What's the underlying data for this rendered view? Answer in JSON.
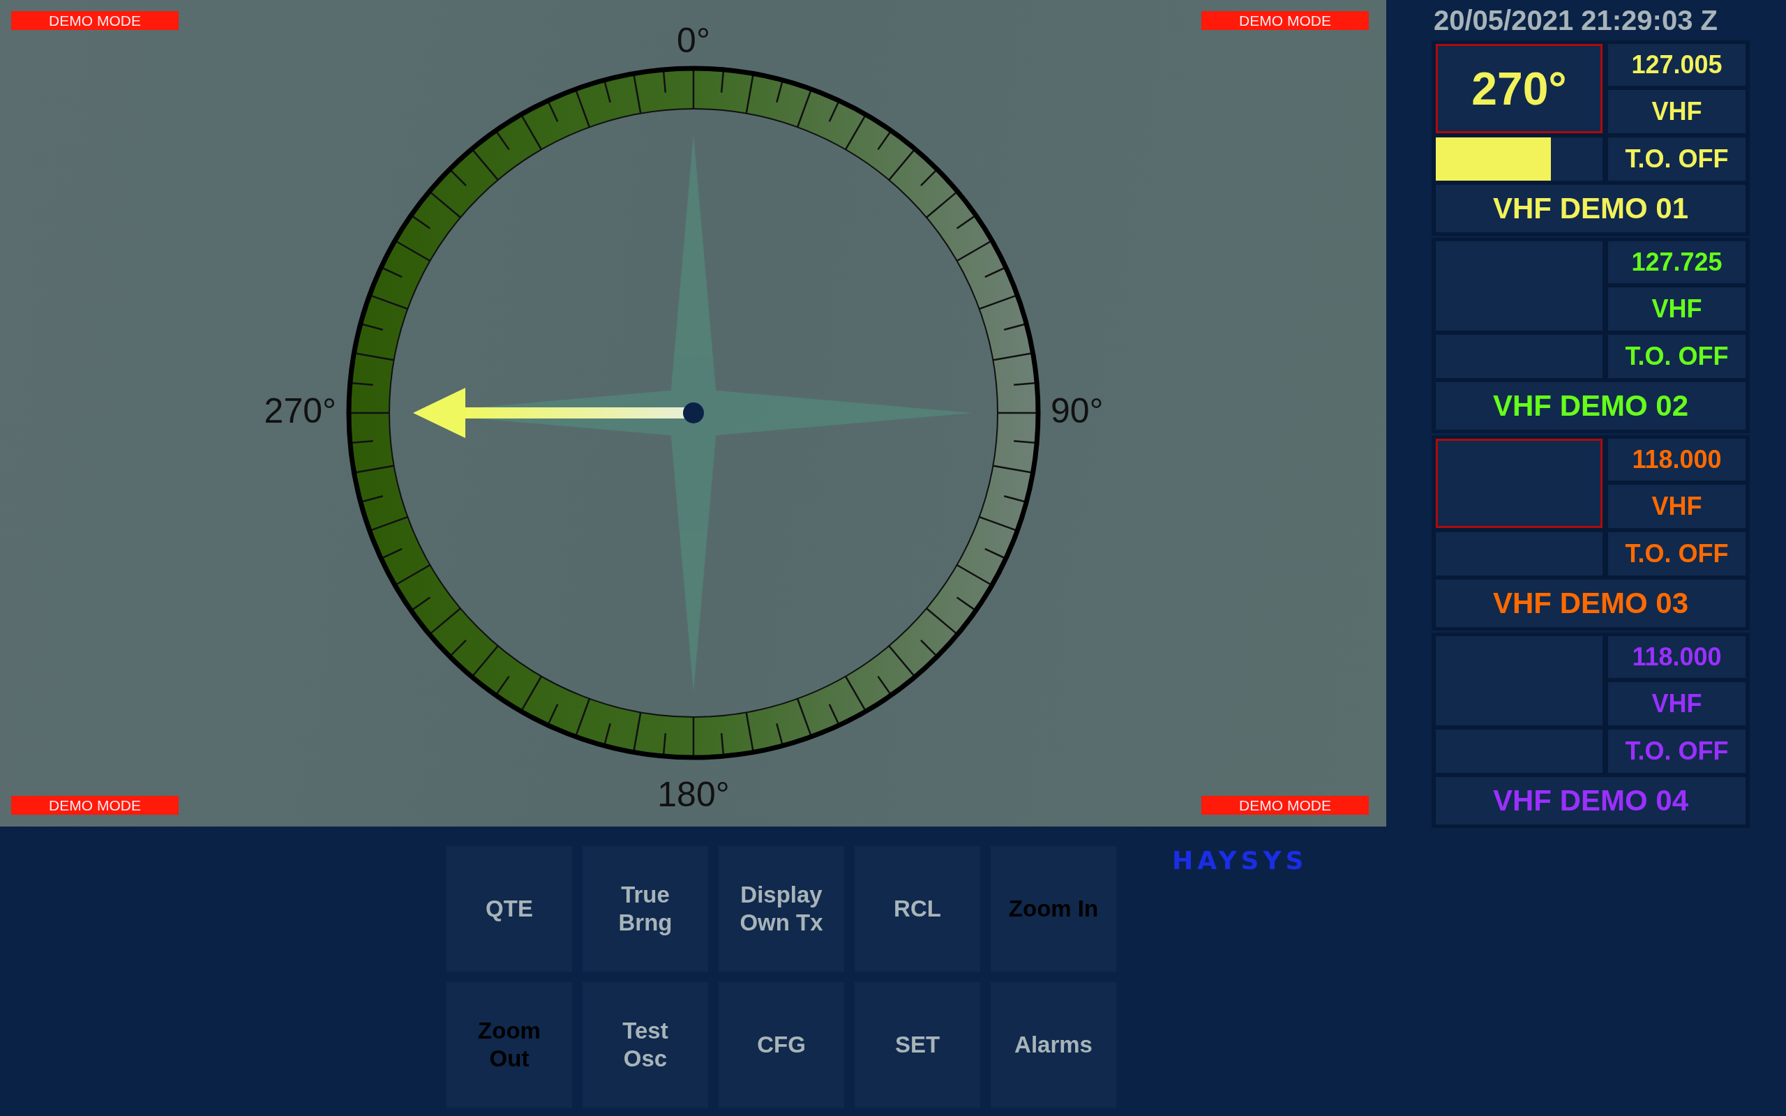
{
  "display": {
    "demo_badges": [
      "DEMO MODE",
      "DEMO MODE",
      "DEMO MODE",
      "DEMO MODE"
    ],
    "compass_labels": [
      "0°",
      "90°",
      "180°",
      "270°"
    ]
  },
  "clock": "20/05/2021 21:29:03 Z",
  "channels": [
    {
      "bearing": "270°",
      "alert": true,
      "level": 0.69,
      "frequency": "127.005",
      "band": "VHF",
      "transmit": "T.O. OFF",
      "name": "VHF DEMO 01",
      "color": "#f2f25a"
    },
    {
      "alert": false,
      "frequency": "127.725",
      "band": "VHF",
      "transmit": "T.O. OFF",
      "name": "VHF DEMO 02",
      "color": "#66ff1a"
    },
    {
      "alert": true,
      "frequency": "118.000",
      "band": "VHF",
      "transmit": "T.O. OFF",
      "name": "VHF DEMO 03",
      "color": "#ff6a00"
    },
    {
      "alert": false,
      "frequency": "118.000",
      "band": "VHF",
      "transmit": "T.O. OFF",
      "name": "VHF DEMO 04",
      "color": "#9b30ff"
    }
  ],
  "buttons": [
    {
      "label": "QTE",
      "disabled": false
    },
    {
      "label": "True Brng",
      "disabled": false
    },
    {
      "label": "Display Own Tx",
      "disabled": false
    },
    {
      "label": "RCL",
      "disabled": false
    },
    {
      "label": "Zoom In",
      "disabled": true
    },
    {
      "label": "Zoom Out",
      "disabled": true
    },
    {
      "label": "Test Osc",
      "disabled": false
    },
    {
      "label": "CFG",
      "disabled": false
    },
    {
      "label": "SET",
      "disabled": false
    },
    {
      "label": "Alarms",
      "disabled": false
    }
  ],
  "logo": "HAYSYS"
}
